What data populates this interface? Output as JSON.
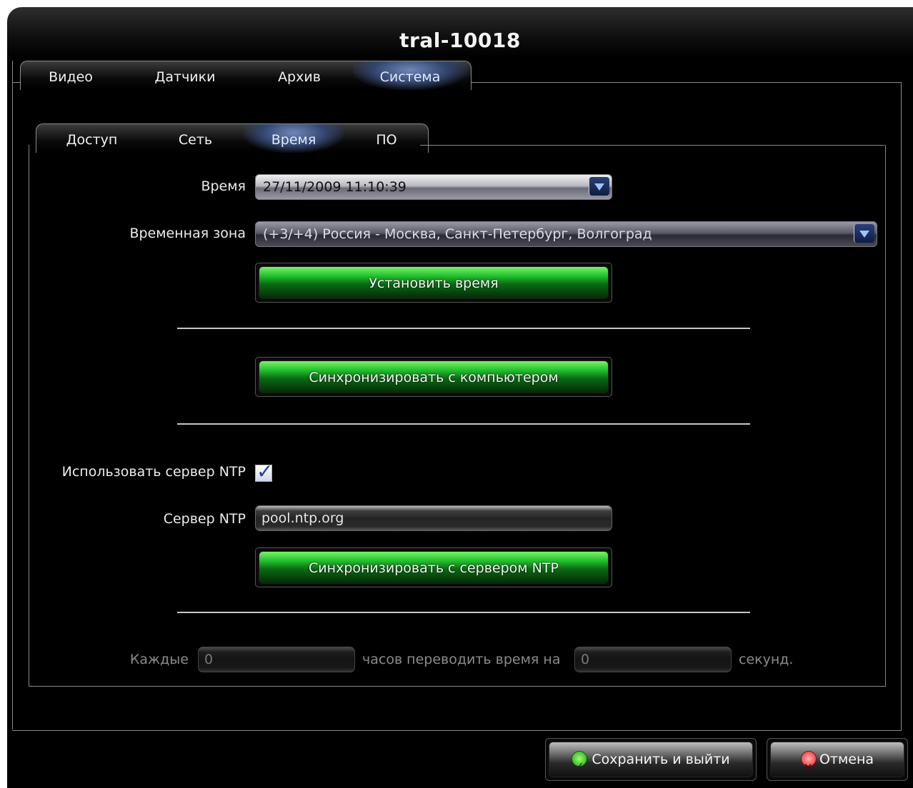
{
  "window": {
    "title": "tral-10018"
  },
  "tabs": [
    "Видео",
    "Датчики",
    "Архив",
    "Система"
  ],
  "subtabs": [
    "Доступ",
    "Сеть",
    "Время",
    "ПО"
  ],
  "time": {
    "label": "Время",
    "value": "27/11/2009 11:10:39",
    "timezone_label": "Временная зона",
    "timezone_value": "(+3/+4) Россия - Москва, Санкт-Петербург, Волгоград",
    "set_button": "Установить время",
    "sync_pc_button": "Синхронизировать с компьютером",
    "ntp_use_label": "Использовать сервер NTP",
    "ntp_use_checked": true,
    "ntp_server_label": "Сервер NTP",
    "ntp_server_value": "pool.ntp.org",
    "sync_ntp_button": "Синхронизировать с сервером NTP",
    "every_label": "Каждые",
    "every_value": "0",
    "shift_label": "часов переводить время на",
    "shift_value": "0",
    "seconds_label": "секунд."
  },
  "footer": {
    "save_label": "Сохранить и выйти",
    "cancel_label": "Отмена"
  },
  "icons": {
    "dropdown": "chevron-down-icon",
    "save": "checkmark-icon",
    "cancel": "cancel-icon"
  },
  "colors": {
    "accent_green": "#1fbe2c",
    "active_tab": "#33456e",
    "background": "#000000"
  }
}
